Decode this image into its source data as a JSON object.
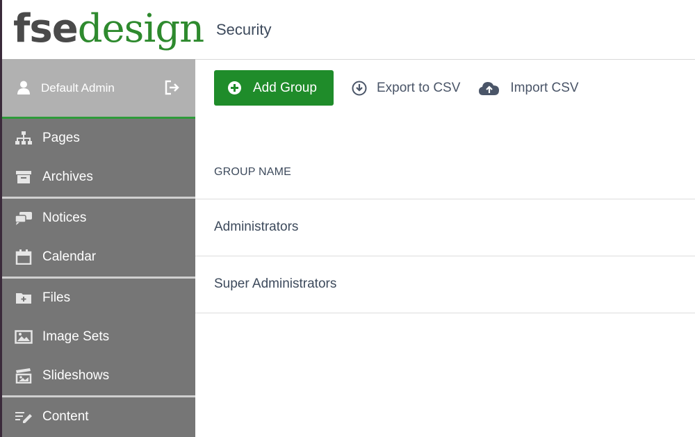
{
  "brand": {
    "logo_part1": "fse",
    "logo_part2": "design",
    "primary": "#2e8a2e"
  },
  "header": {
    "title": "Security"
  },
  "sidebar": {
    "user": {
      "name": "Default Admin",
      "icon": "user-icon",
      "logout_icon": "logout-icon"
    },
    "items": [
      {
        "label": "Pages",
        "icon": "sitemap-icon"
      },
      {
        "label": "Archives",
        "icon": "archive-icon"
      },
      {
        "label": "Notices",
        "icon": "comments-icon"
      },
      {
        "label": "Calendar",
        "icon": "calendar-icon"
      },
      {
        "label": "Files",
        "icon": "folder-plus-icon"
      },
      {
        "label": "Image Sets",
        "icon": "image-icon"
      },
      {
        "label": "Slideshows",
        "icon": "slideshow-icon"
      },
      {
        "label": "Content",
        "icon": "content-edit-icon"
      }
    ]
  },
  "toolbar": {
    "add_label": "Add Group",
    "export_label": "Export to CSV",
    "import_label": "Import CSV"
  },
  "table": {
    "column_header": "GROUP NAME",
    "rows": [
      "Administrators",
      "Super Administrators"
    ]
  }
}
